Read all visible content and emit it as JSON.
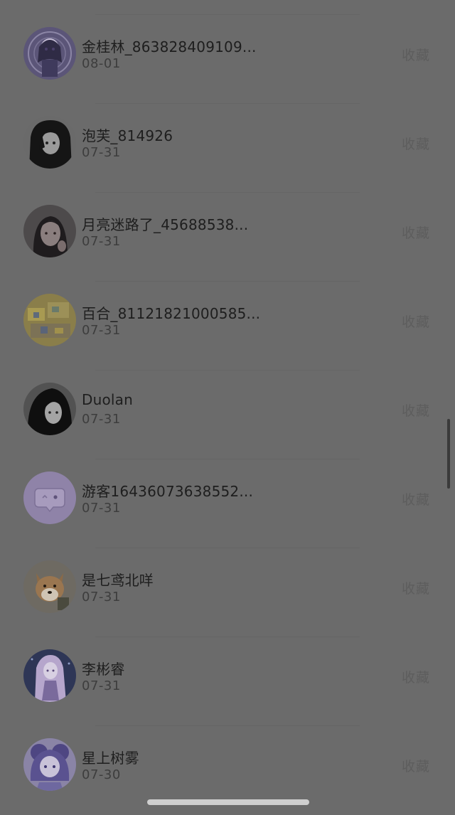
{
  "action_label": "收藏",
  "users": [
    {
      "name": "金桂林_863828409109...",
      "date": "08-01",
      "avatar": "anime-purple-avatar"
    },
    {
      "name": "泡芙_814926",
      "date": "07-31",
      "avatar": "anime-black-hair-avatar"
    },
    {
      "name": "月亮迷路了_45688538...",
      "date": "07-31",
      "avatar": "girl-photo-avatar"
    },
    {
      "name": "百合_81121821000585...",
      "date": "07-31",
      "avatar": "yellow-scene-avatar"
    },
    {
      "name": "Duolan",
      "date": "07-31",
      "avatar": "anime-hooded-avatar"
    },
    {
      "name": "游客16436073638552...",
      "date": "07-31",
      "avatar": "default-chat-bubble-avatar"
    },
    {
      "name": "是七鸢北咩",
      "date": "07-31",
      "avatar": "shiba-dog-avatar"
    },
    {
      "name": "李彬睿",
      "date": "07-31",
      "avatar": "anime-lavender-avatar"
    },
    {
      "name": "星上树雾",
      "date": "07-30",
      "avatar": "anime-purple-sketch-avatar"
    }
  ],
  "colors": {
    "overlay_background": "#6b6b6b",
    "default_avatar_purple": "#8f83a8",
    "home_indicator": "#cfcfcf"
  }
}
